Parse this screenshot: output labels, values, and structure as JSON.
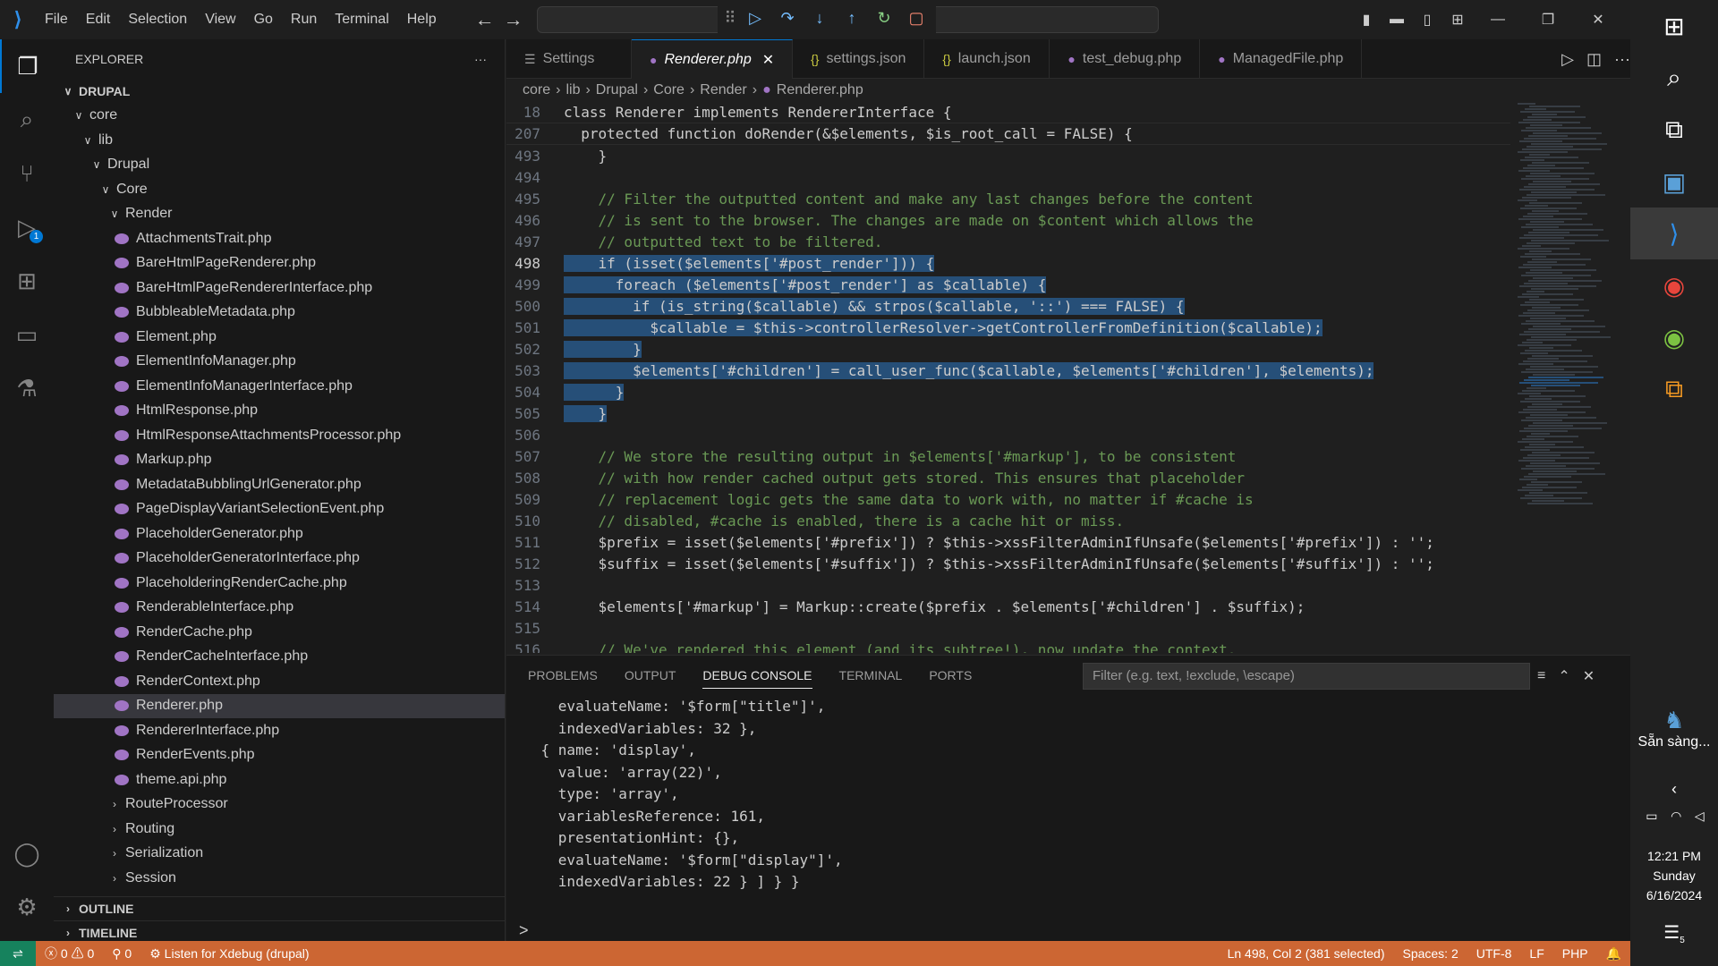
{
  "titlebar": {
    "menu": [
      "File",
      "Edit",
      "Selection",
      "View",
      "Go",
      "Run",
      "Terminal",
      "Help"
    ]
  },
  "activity": {
    "debug_badge": "1"
  },
  "explorer": {
    "title": "EXPLORER",
    "more": "···",
    "folders": [
      "DRUPAL",
      "core",
      "lib",
      "Drupal",
      "Core",
      "Render"
    ],
    "files": [
      "AttachmentsTrait.php",
      "BareHtmlPageRenderer.php",
      "BareHtmlPageRendererInterface.php",
      "BubbleableMetadata.php",
      "Element.php",
      "ElementInfoManager.php",
      "ElementInfoManagerInterface.php",
      "HtmlResponse.php",
      "HtmlResponseAttachmentsProcessor.php",
      "Markup.php",
      "MetadataBubblingUrlGenerator.php",
      "PageDisplayVariantSelectionEvent.php",
      "PlaceholderGenerator.php",
      "PlaceholderGeneratorInterface.php",
      "PlaceholderingRenderCache.php",
      "RenderableInterface.php",
      "RenderCache.php",
      "RenderCacheInterface.php",
      "RenderContext.php",
      "Renderer.php",
      "RendererInterface.php",
      "RenderEvents.php",
      "theme.api.php"
    ],
    "subfolders": [
      "RouteProcessor",
      "Routing",
      "Serialization",
      "Session"
    ],
    "outline": "OUTLINE",
    "timeline": "TIMELINE"
  },
  "tabs": [
    "Settings",
    "Renderer.php",
    "settings.json",
    "launch.json",
    "test_debug.php",
    "ManagedFile.php"
  ],
  "breadcrumb": [
    "core",
    "lib",
    "Drupal",
    "Core",
    "Render",
    "Renderer.php"
  ],
  "code": {
    "sticky": [
      {
        "n": "18",
        "t": "class Renderer implements RendererInterface {"
      },
      {
        "n": "207",
        "t": "  protected function doRender(&$elements, $is_root_call = FALSE) {"
      }
    ],
    "lines": [
      {
        "n": "493",
        "t": "    }"
      },
      {
        "n": "494",
        "t": ""
      },
      {
        "n": "495",
        "t": "    // Filter the outputted content and make any last changes before the content"
      },
      {
        "n": "496",
        "t": "    // is sent to the browser. The changes are made on $content which allows the"
      },
      {
        "n": "497",
        "t": "    // outputted text to be filtered."
      },
      {
        "n": "498",
        "t": "    if (isset($elements['#post_render'])) {"
      },
      {
        "n": "499",
        "t": "      foreach ($elements['#post_render'] as $callable) {"
      },
      {
        "n": "500",
        "t": "        if (is_string($callable) && strpos($callable, '::') === FALSE) {"
      },
      {
        "n": "501",
        "t": "          $callable = $this->controllerResolver->getControllerFromDefinition($callable);"
      },
      {
        "n": "502",
        "t": "        }"
      },
      {
        "n": "503",
        "t": "        $elements['#children'] = call_user_func($callable, $elements['#children'], $elements);"
      },
      {
        "n": "504",
        "t": "      }"
      },
      {
        "n": "505",
        "t": "    }"
      },
      {
        "n": "506",
        "t": ""
      },
      {
        "n": "507",
        "t": "    // We store the resulting output in $elements['#markup'], to be consistent"
      },
      {
        "n": "508",
        "t": "    // with how render cached output gets stored. This ensures that placeholder"
      },
      {
        "n": "509",
        "t": "    // replacement logic gets the same data to work with, no matter if #cache is"
      },
      {
        "n": "510",
        "t": "    // disabled, #cache is enabled, there is a cache hit or miss."
      },
      {
        "n": "511",
        "t": "    $prefix = isset($elements['#prefix']) ? $this->xssFilterAdminIfUnsafe($elements['#prefix']) : '';"
      },
      {
        "n": "512",
        "t": "    $suffix = isset($elements['#suffix']) ? $this->xssFilterAdminIfUnsafe($elements['#suffix']) : '';"
      },
      {
        "n": "513",
        "t": ""
      },
      {
        "n": "514",
        "t": "    $elements['#markup'] = Markup::create($prefix . $elements['#children'] . $suffix);"
      },
      {
        "n": "515",
        "t": ""
      },
      {
        "n": "516",
        "t": "    // We've rendered this element (and its subtree!), now update the context."
      }
    ]
  },
  "panel": {
    "tabs": [
      "PROBLEMS",
      "OUTPUT",
      "DEBUG CONSOLE",
      "TERMINAL",
      "PORTS"
    ],
    "filter_placeholder": "Filter (e.g. text, !exclude, \\escape)",
    "console": [
      "      evaluateName: '$form[\"title\"]',",
      "      indexedVariables: 32 },",
      "    { name: 'display',",
      "      value: 'array(22)',",
      "      type: 'array',",
      "      variablesReference: 161,",
      "      presentationHint: {},",
      "      evaluateName: '$form[\"display\"]',",
      "      indexedVariables: 22 } ] } }"
    ],
    "prompt": ">"
  },
  "status": {
    "errors": "0",
    "warnings": "0",
    "ports": "0",
    "debug": "Listen for Xdebug (drupal)",
    "position": "Ln 498, Col 2 (381 selected)",
    "spaces": "Spaces: 2",
    "encoding": "UTF-8",
    "eol": "LF",
    "language": "PHP"
  },
  "taskbar": {
    "status_text": "Sẵn sàng...",
    "time": "12:21 PM",
    "day": "Sunday",
    "date": "6/16/2024",
    "notif_count": "5"
  },
  "colors": {
    "accent": "#0078d4",
    "statusbar": "#cc6633",
    "selection": "#264f78"
  }
}
